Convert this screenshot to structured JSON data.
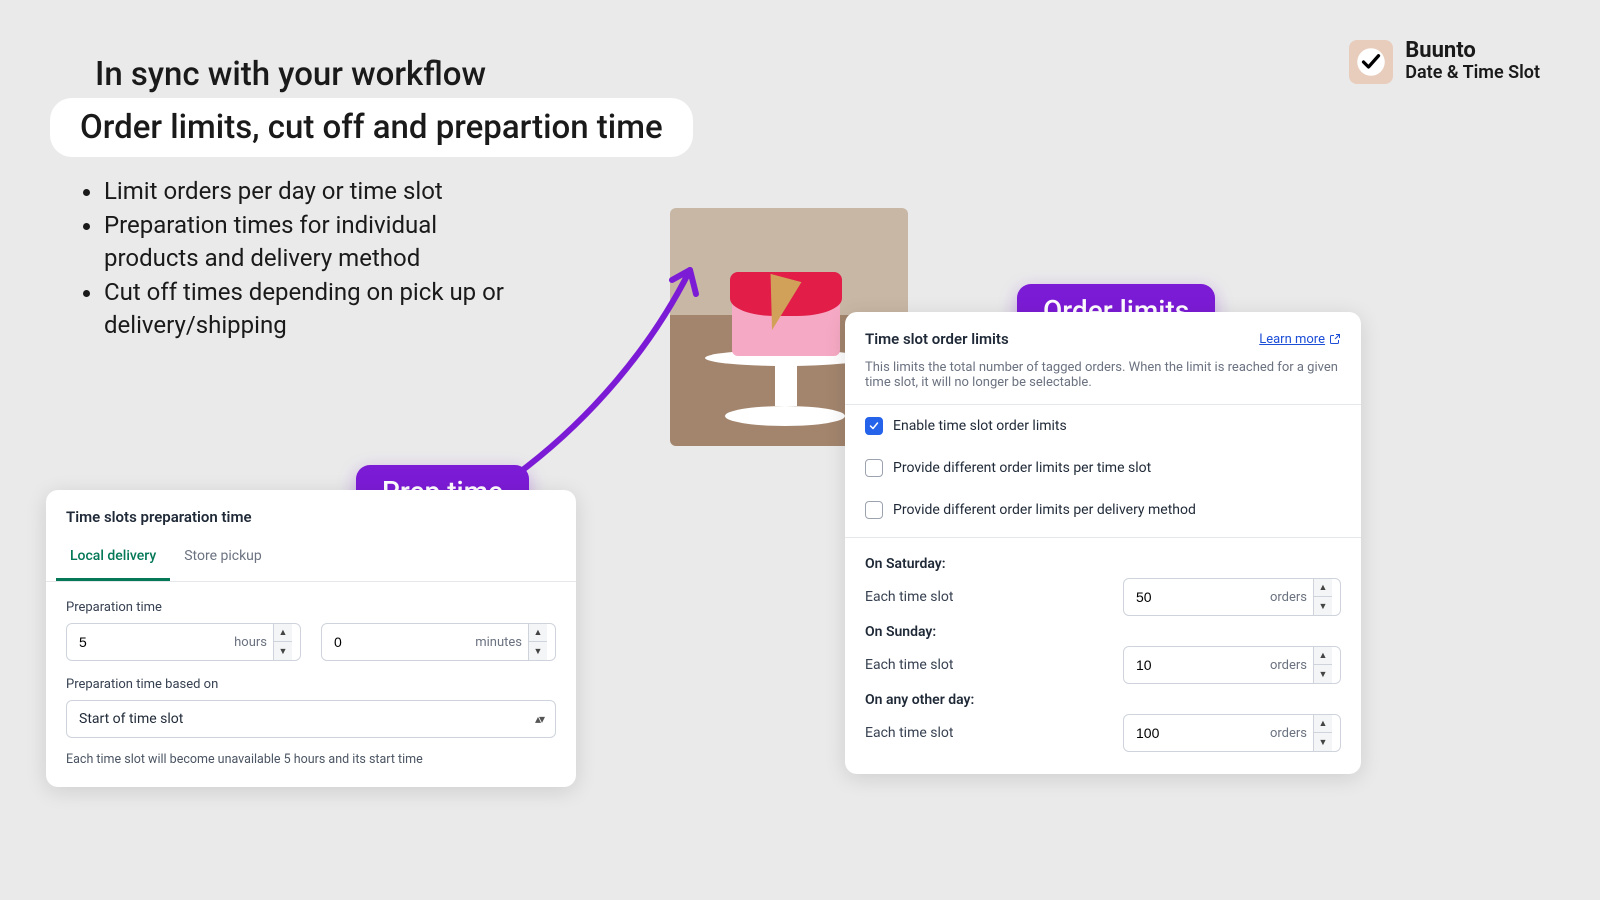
{
  "heading": "In sync with your workflow",
  "subheading": "Order limits, cut off and prepartion time",
  "bullets": [
    "Limit orders per day or time slot",
    "Preparation times for individual products and delivery method",
    "Cut off times depending on pick up or delivery/shipping"
  ],
  "brand": {
    "name": "Buunto",
    "tagline": "Date & Time Slot"
  },
  "badges": {
    "prep": "Prep time",
    "limits": "Order limits"
  },
  "prep": {
    "title": "Time slots preparation time",
    "tabs": [
      "Local delivery",
      "Store pickup"
    ],
    "active_tab": 0,
    "prep_label": "Preparation time",
    "hours": "5",
    "hours_unit": "hours",
    "minutes": "0",
    "minutes_unit": "minutes",
    "based_label": "Preparation time based on",
    "based_value": "Start of time slot",
    "hint": "Each time slot will become unavailable 5 hours and its start time"
  },
  "limits": {
    "title": "Time slot order limits",
    "learn": "Learn more",
    "desc": "This limits the total number of tagged orders. When the limit is reached for a given time slot, it will no longer be selectable.",
    "checks": [
      {
        "label": "Enable time slot order limits",
        "checked": true
      },
      {
        "label": "Provide different order limits per time slot",
        "checked": false
      },
      {
        "label": "Provide different order limits per delivery method",
        "checked": false
      }
    ],
    "days": [
      {
        "heading": "On Saturday:",
        "row_label": "Each time slot",
        "value": "50",
        "unit": "orders"
      },
      {
        "heading": "On Sunday:",
        "row_label": "Each time slot",
        "value": "10",
        "unit": "orders"
      },
      {
        "heading": "On any other day:",
        "row_label": "Each time slot",
        "value": "100",
        "unit": "orders"
      }
    ]
  }
}
